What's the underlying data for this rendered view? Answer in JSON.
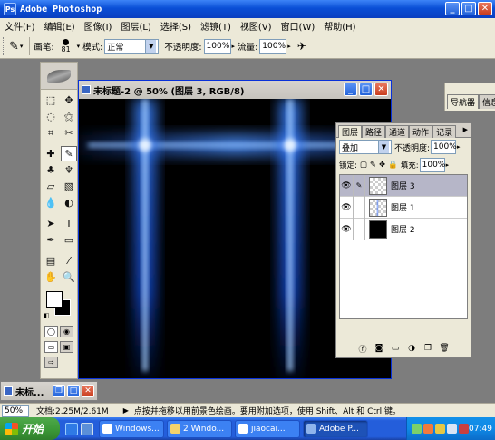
{
  "app": {
    "title": "Adobe Photoshop"
  },
  "window_controls": {
    "minimize": "_",
    "maximize": "□",
    "close": "✕"
  },
  "menubar": [
    "文件(F)",
    "编辑(E)",
    "图像(I)",
    "图层(L)",
    "选择(S)",
    "滤镜(T)",
    "视图(V)",
    "窗口(W)",
    "帮助(H)"
  ],
  "options_bar": {
    "brush_label": "画笔:",
    "brush_size": "81",
    "mode_label": "模式:",
    "mode_value": "正常",
    "opacity_label": "不透明度:",
    "opacity_value": "100%",
    "flow_label": "流量:",
    "flow_value": "100%"
  },
  "palette_tabs": [
    "导航器",
    "信息"
  ],
  "document": {
    "title": "未标题-2 @ 50% (图层 3, RGB/8)"
  },
  "layers_palette": {
    "tabs": [
      "图层",
      "路径",
      "通道",
      "动作",
      "记录"
    ],
    "blend_mode": "叠加",
    "opacity_label": "不透明度:",
    "opacity_value": "100%",
    "lock_label": "锁定:",
    "fill_label": "填充:",
    "fill_value": "100%",
    "layers": [
      {
        "name": "图层 3",
        "selected": true,
        "thumb": "checker"
      },
      {
        "name": "图层 1",
        "selected": false,
        "thumb": "checker-blue"
      },
      {
        "name": "图层 2",
        "selected": false,
        "thumb": "black"
      }
    ]
  },
  "minimized_window": {
    "title": "未标..."
  },
  "statusbar": {
    "zoom": "50%",
    "doc_info": "文档:2.25M/2.61M",
    "hint": "点按并拖移以用前景色绘画。要用附加选项，使用 Shift、Alt 和 Ctrl 键。"
  },
  "taskbar": {
    "start_label": "开始",
    "tasks": [
      "Windows...",
      "2 Windo...",
      "jiaocai...",
      "Adobe P..."
    ],
    "clock": "07:49"
  },
  "colors": {
    "glow": "#1e6bff",
    "title_blue": "#0a4fd6",
    "chrome": "#ece9d8"
  }
}
